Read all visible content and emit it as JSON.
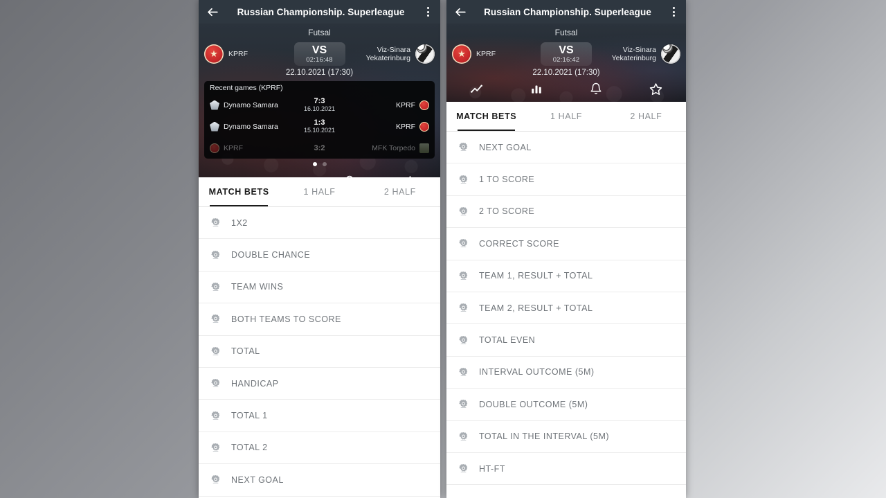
{
  "app": {
    "title": "Russian Championship. Superleague",
    "back_icon": "arrow-left-icon",
    "overflow_icon": "kebab-menu-icon"
  },
  "match": {
    "sport": "Futsal",
    "vs_label": "VS",
    "date": "22.10.2021 (17:30)",
    "team1": {
      "name": "KPRF",
      "logo": "kprf-logo"
    },
    "team2": {
      "name": "Viz-Sinara\nYekaterinburg",
      "logo": "viz-sinara-logo"
    }
  },
  "left_panel": {
    "timer": "02:16:48",
    "recent_games": {
      "title": "Recent games (KPRF)",
      "rows": [
        {
          "home": "Dynamo Samara",
          "score": "7:3",
          "date": "16.10.2021",
          "away": "KPRF",
          "home_badge": "dynamo-badge",
          "away_badge": "kprf-badge"
        },
        {
          "home": "Dynamo Samara",
          "score": "1:3",
          "date": "15.10.2021",
          "away": "KPRF",
          "home_badge": "dynamo-badge",
          "away_badge": "kprf-badge"
        },
        {
          "home": "KPRF",
          "score": "3:2",
          "date": "",
          "away": "MFK Torpedo",
          "home_badge": "kprf-badge",
          "away_badge": "torpedo-badge"
        }
      ]
    },
    "pager": {
      "total": 2,
      "active": 1
    },
    "hero_icons": [
      "trending-line-icon",
      "bar-chart-icon",
      "bell-icon",
      "star-icon"
    ],
    "tabs": [
      {
        "label": "MATCH BETS",
        "active": true
      },
      {
        "label": "1 HALF",
        "active": false
      },
      {
        "label": "2 HALF",
        "active": false
      }
    ],
    "bets": [
      "1X2",
      "DOUBLE CHANCE",
      "TEAM WINS",
      "BOTH TEAMS TO SCORE",
      "TOTAL",
      "HANDICAP",
      "TOTAL 1",
      "TOTAL 2",
      "NEXT GOAL"
    ]
  },
  "right_panel": {
    "timer": "02:16:42",
    "hero_icons": [
      "trending-line-icon",
      "bar-chart-icon",
      "bell-icon",
      "star-icon"
    ],
    "tabs": [
      {
        "label": "MATCH BETS",
        "active": true
      },
      {
        "label": "1 HALF",
        "active": false
      },
      {
        "label": "2 HALF",
        "active": false
      }
    ],
    "bets": [
      "NEXT GOAL",
      "1 TO SCORE",
      "2 TO SCORE",
      "CORRECT SCORE",
      "TEAM 1, RESULT + TOTAL",
      "TEAM 2, RESULT + TOTAL",
      "TOTAL EVEN",
      "INTERVAL OUTCOME (5M)",
      "DOUBLE OUTCOME (5M)",
      "TOTAL IN THE INTERVAL (5M)",
      "HT-FT"
    ]
  },
  "colors": {
    "appbar": "#2e3740",
    "hero_dark": "#1d2229",
    "tab_active": "#1b1b1b",
    "bet_label": "#6f7479",
    "accent_red": "#c7282a"
  }
}
